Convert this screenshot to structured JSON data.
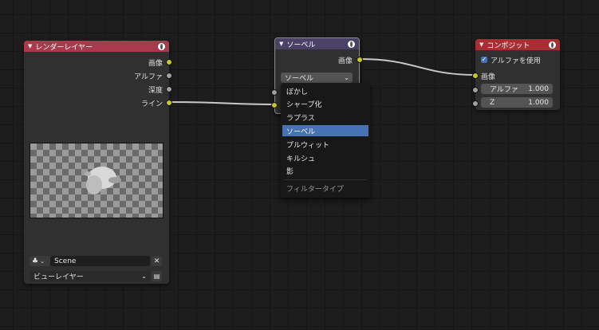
{
  "render_layers_node": {
    "title": "レンダーレイヤー",
    "outputs": [
      "画像",
      "アルファ",
      "深度",
      "ライン"
    ],
    "scene_value": "Scene",
    "view_layer_value": "ビューレイヤー",
    "header_color": "#a83a4b"
  },
  "sobel_node": {
    "title": "ソーベル",
    "output_label": "画像",
    "filter_select_value": "ソーベル",
    "header_color": "#4a4167"
  },
  "filter_menu": {
    "items": [
      "ぼかし",
      "シャープ化",
      "ラプラス",
      "ソーベル",
      "プルウィット",
      "キルシュ",
      "影"
    ],
    "active_index": 3,
    "title": "フィルタータイプ",
    "active_color": "#4772b3"
  },
  "composite_node": {
    "title": "コンポジット",
    "use_alpha_label": "アルファを使用",
    "use_alpha_checked": true,
    "image_input_label": "画像",
    "alpha_label": "アルファ",
    "alpha_value": "1.000",
    "z_label": "Z",
    "z_value": "1.000",
    "header_color": "#a82e33"
  }
}
